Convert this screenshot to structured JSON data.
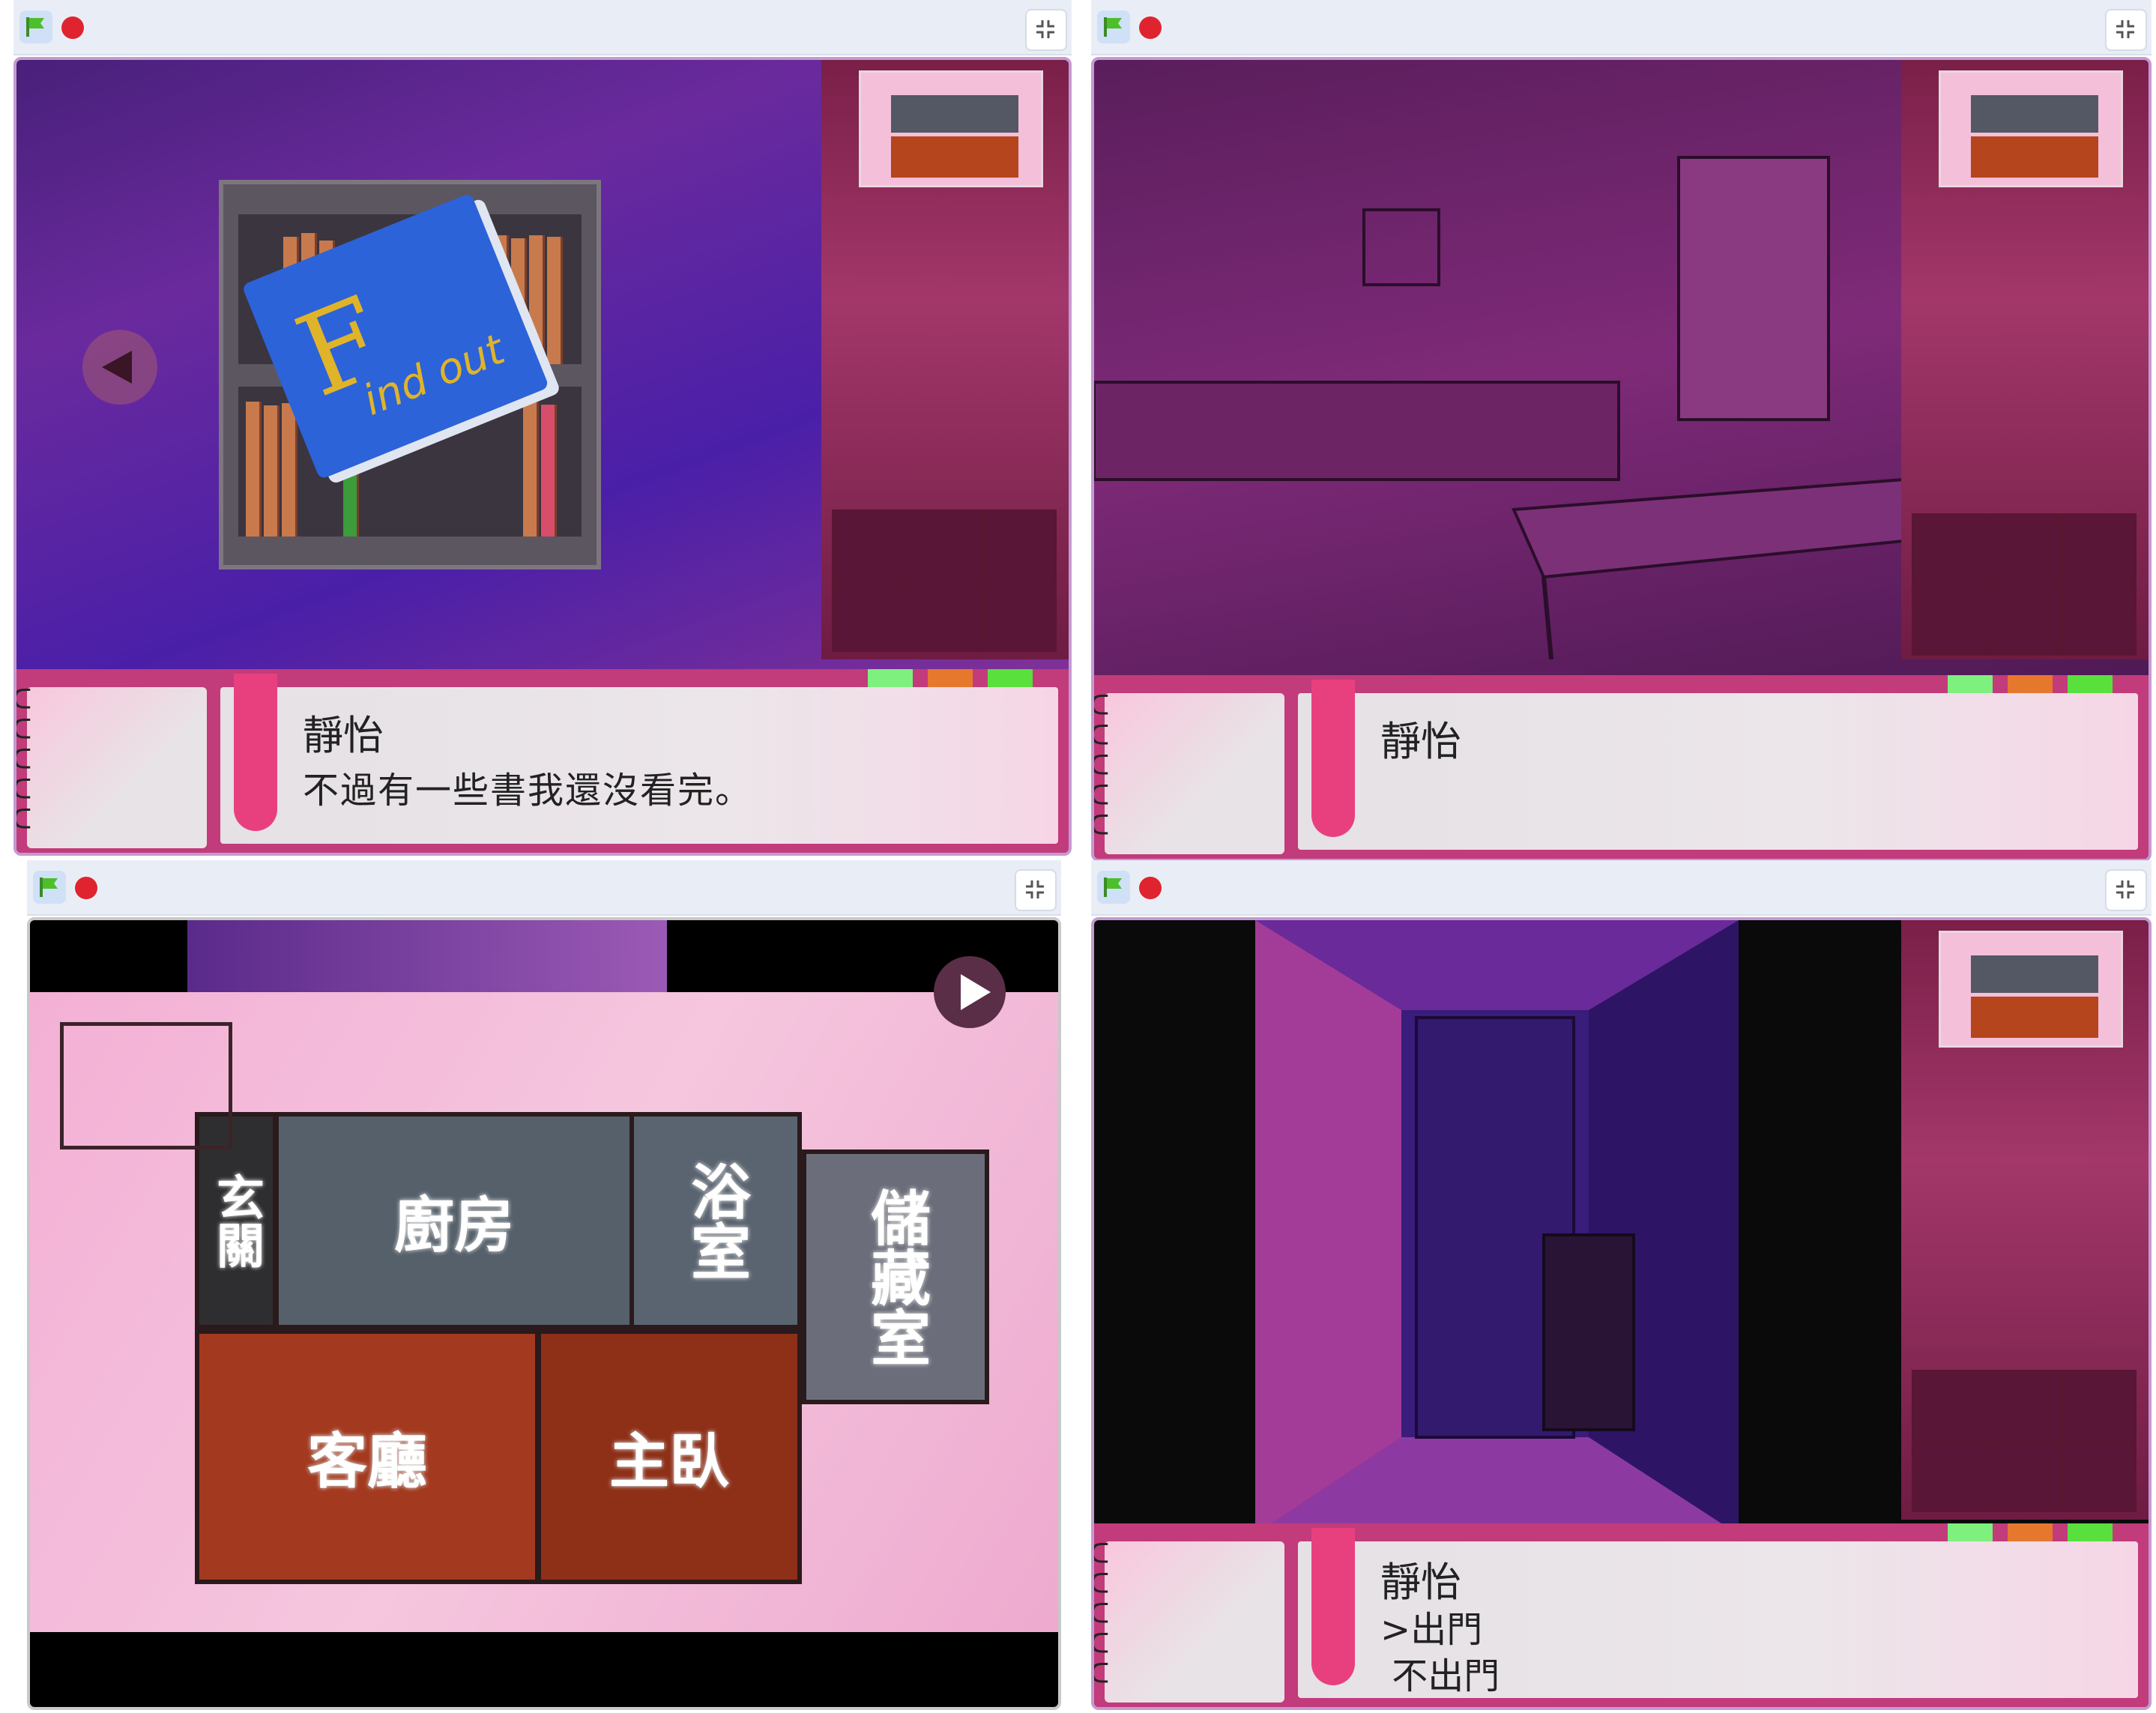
{
  "panels": [
    {
      "id": "bedroom",
      "dialog": {
        "speaker": "靜怡",
        "text": "不過有一些書我還沒看完。"
      },
      "book": {
        "title": "ind out",
        "letter": "F"
      }
    },
    {
      "id": "kitchen",
      "dialog": {
        "speaker": "靜怡",
        "text": ""
      }
    },
    {
      "id": "map",
      "rooms": {
        "entrance": "玄關",
        "kitchen": "廚房",
        "bathroom": "浴室",
        "storage": "儲藏室",
        "living": "客廳",
        "master": "主臥"
      }
    },
    {
      "id": "hallway",
      "dialog": {
        "speaker": "靜怡",
        "options": [
          ">出門",
          " 不出門"
        ]
      }
    }
  ],
  "icons": {
    "green_flag": "green-flag-icon",
    "stop": "stop-icon",
    "fullscreen": "fullscreen-exit-icon"
  },
  "colors": {
    "accent_pink": "#e8407f",
    "dialog_bg": "#c23b7b",
    "chip_green": "#7ef07e",
    "chip_orange": "#e6782e",
    "chip_lime": "#59e03d"
  }
}
